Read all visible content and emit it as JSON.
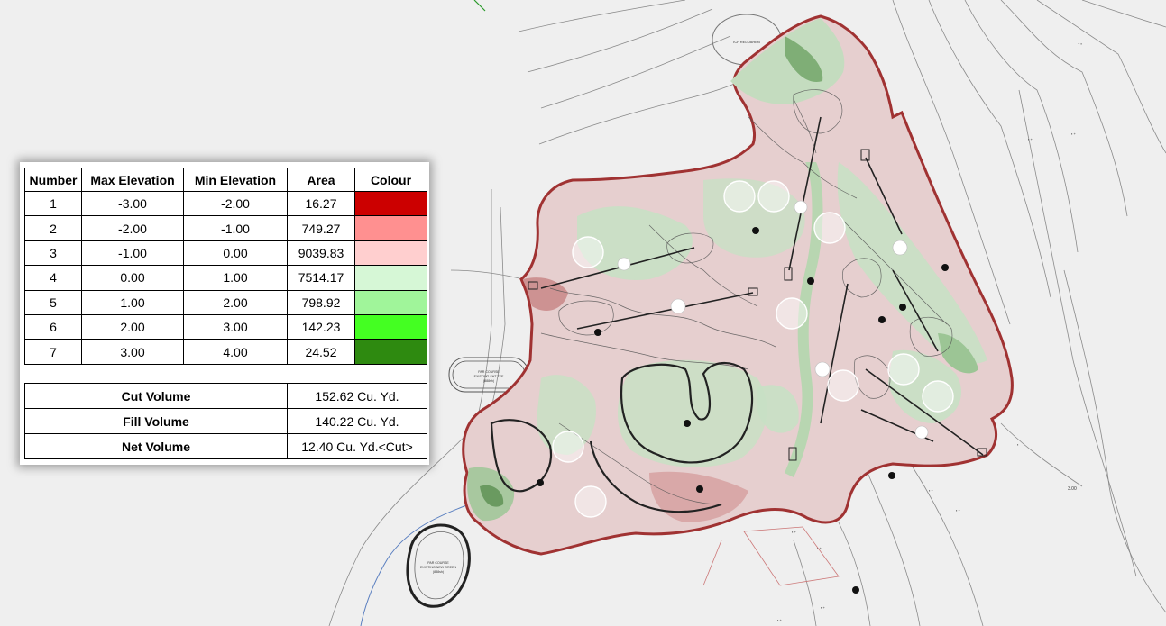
{
  "table": {
    "headers": [
      "Number",
      "Max Elevation",
      "Min Elevation",
      "Area",
      "Colour"
    ],
    "rows": [
      {
        "number": "1",
        "max": "-3.00",
        "min": "-2.00",
        "area": "16.27",
        "colour": "#cc0000"
      },
      {
        "number": "2",
        "max": "-2.00",
        "min": "-1.00",
        "area": "749.27",
        "colour": "#ff9090"
      },
      {
        "number": "3",
        "max": "-1.00",
        "min": "0.00",
        "area": "9039.83",
        "colour": "#ffcfcf"
      },
      {
        "number": "4",
        "max": "0.00",
        "min": "1.00",
        "area": "7514.17",
        "colour": "#d6f7d6"
      },
      {
        "number": "5",
        "max": "1.00",
        "min": "2.00",
        "area": "798.92",
        "colour": "#a0f59a"
      },
      {
        "number": "6",
        "max": "2.00",
        "min": "3.00",
        "area": "142.23",
        "colour": "#44ff22"
      },
      {
        "number": "7",
        "max": "3.00",
        "min": "4.00",
        "area": "24.52",
        "colour": "#2e8a10"
      }
    ]
  },
  "volumes": {
    "cut_label": "Cut Volume",
    "cut_value": "152.62 Cu. Yd.",
    "fill_label": "Fill Volume",
    "fill_value": "140.22 Cu. Yd.",
    "net_label": "Net Volume",
    "net_value": "12.40 Cu. Yd.<Cut>"
  },
  "map": {
    "labels": {
      "top_circle": "ICF RELOAREN",
      "left_course": "PAR COURSE\nEXISTING SHT TEE\n(888sh)",
      "bottom_course": "PAR COURSE\nEXISTING NEW GREEN\n(888sh)",
      "elev_right": "3.00"
    },
    "colors": {
      "boundary": "#a03232",
      "cut_fill": "#e6c4c4",
      "fill_fill": "#c8e0c4"
    }
  }
}
